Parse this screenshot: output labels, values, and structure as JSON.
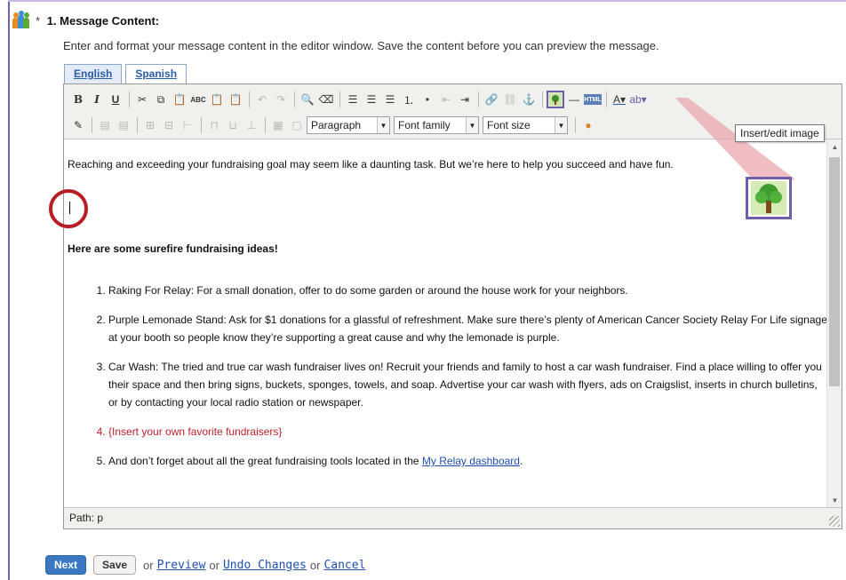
{
  "step": {
    "required_mark": "*",
    "title": "1. Message Content:",
    "intro": "Enter and format your message content in the editor window. Save the content before you can preview the message."
  },
  "tabs": [
    {
      "label": "English",
      "active": true
    },
    {
      "label": "Spanish",
      "active": false
    }
  ],
  "toolbar": {
    "row1": [
      "bold-button",
      "italic-button",
      "underline-button",
      "cut-icon",
      "copy-icon",
      "paste-icon",
      "spellcheck-icon",
      "paste-text-icon",
      "paste-word-icon",
      "undo-icon",
      "redo-icon",
      "find-replace-icon",
      "clear-format-icon",
      "align-left-icon",
      "align-center-icon",
      "align-right-icon",
      "ordered-list-icon",
      "unordered-list-icon",
      "outdent-icon",
      "indent-icon",
      "link-icon",
      "unlink-icon",
      "anchor-icon",
      "insert-image-icon",
      "horizontal-rule-icon",
      "html-icon",
      "text-color-icon",
      "highlight-icon"
    ],
    "bold": "B",
    "italic": "I",
    "underline": "U",
    "paragraph_select": "Paragraph",
    "font_family_select": "Font family",
    "font_size_select": "Font size",
    "tooltip": "Insert/edit image"
  },
  "content": {
    "intro_line": "Reaching and exceeding your fundraising goal may seem like a daunting task. But we’re here to help you succeed and have fun.",
    "subhead": "Here are some surefire fundraising ideas!",
    "ideas": [
      {
        "text": "Raking For Relay: For a small donation, offer to do some garden or around the house work for your neighbors."
      },
      {
        "text": "Purple Lemonade Stand: Ask for $1 donations for a glassful of refreshment. Make sure there’s plenty of American Cancer Society Relay For Life signage at your booth so people know they’re supporting a great cause and why the lemonade is purple."
      },
      {
        "text": "Car Wash: The tried and true car wash fundraiser lives on! Recruit your friends and family to host a car wash fundraiser. Find a place willing to offer you their space and then bring signs, buckets, sponges, towels, and soap. Advertise your car wash with flyers, ads on Craigslist, inserts in church bulletins, or by contacting your local radio station or newspaper."
      },
      {
        "text": "{Insert your own favorite fundraisers}"
      },
      {
        "text": "And don’t forget about all the great fundraising tools located in the ",
        "link": "My Relay dashboard",
        "after": "."
      }
    ]
  },
  "statusbar": {
    "path": "Path: p"
  },
  "actions": {
    "next": "Next",
    "save": "Save",
    "or": "or",
    "preview": "Preview",
    "undo": "Undo Changes",
    "cancel": "Cancel"
  },
  "colors": {
    "accent_purple": "#6d5fa8",
    "callout_red": "#b81c24",
    "link_blue": "#1f4fb0",
    "primary_button": "#3a79c2"
  }
}
